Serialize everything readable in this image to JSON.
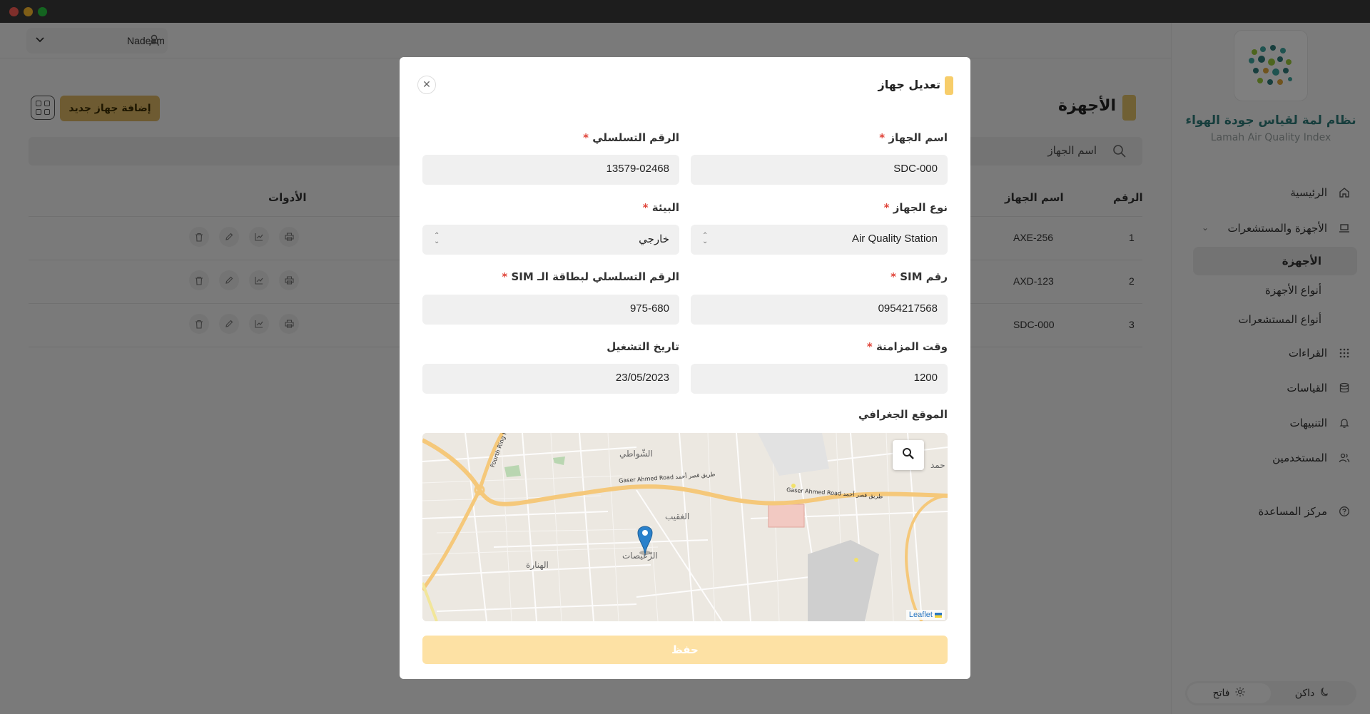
{
  "window": {
    "controls": [
      "close",
      "minimize",
      "maximize"
    ]
  },
  "sidebar": {
    "app_title": "نظام لمة لقياس جودة الهواء",
    "app_subtitle": "Lamah Air Quality Index",
    "items": [
      {
        "label": "الرئيسية",
        "icon": "home-icon"
      },
      {
        "label": "الأجهزة والمستشعرات",
        "icon": "laptop-icon"
      },
      {
        "label": "القراءات",
        "icon": "grid-dots-icon"
      },
      {
        "label": "القياسات",
        "icon": "database-icon"
      },
      {
        "label": "التنبيهات",
        "icon": "bell-icon"
      },
      {
        "label": "المستخدمين",
        "icon": "users-icon"
      },
      {
        "label": "مركز المساعدة",
        "icon": "help-icon"
      }
    ],
    "sub_items": [
      {
        "label": "الأجهزة",
        "active": true
      },
      {
        "label": "أنواع الأجهزة",
        "active": false
      },
      {
        "label": "أنواع المستشعرات",
        "active": false
      }
    ],
    "theme": {
      "dark_label": "داكن",
      "light_label": "فاتح",
      "selected": "light"
    }
  },
  "header": {
    "user_name": "Nadeem"
  },
  "main": {
    "title": "الأجهزة",
    "add_button": "إضافة جهاز جديد",
    "search_placeholder": "اسم الجهاز",
    "columns": {
      "number": "الرقم",
      "name": "اسم الجهاز",
      "tools": "الأدوات"
    },
    "rows": [
      {
        "number": "1",
        "name": "AXE-256"
      },
      {
        "number": "2",
        "name": "AXD-123"
      },
      {
        "number": "3",
        "name": "SDC-000"
      }
    ]
  },
  "modal": {
    "title": "تعديل جهاز",
    "fields": {
      "device_name": {
        "label": "اسم الجهاز",
        "value": "SDC-000"
      },
      "serial_number": {
        "label": "الرقم التسلسلي",
        "value": "13579-02468"
      },
      "device_type": {
        "label": "نوع الجهاز",
        "value": "Air Quality Station"
      },
      "environment": {
        "label": "البيئة",
        "value": "خارجي"
      },
      "sim_number": {
        "label": "رقم SIM",
        "value": "0954217568"
      },
      "sim_serial": {
        "label": "الرقم التسلسلي لبطاقة الـ SIM",
        "value": "975-680"
      },
      "sync_time": {
        "label": "وقت المزامنة",
        "value": "1200"
      },
      "start_date": {
        "label": "تاريخ التشغيل",
        "value": "23/05/2023"
      }
    },
    "location_label": "الموقع الجغرافي",
    "map": {
      "labels": {
        "shawahi": "الشّواطي",
        "ghuqaib": "الغقيب",
        "zuaisat": "الزّعيصات",
        "hunara": "الهنارة",
        "hamad": "حمد",
        "road1": "Gaser Ahmed Road طريق قصر أحمد",
        "road2": "Gaser Ahmed Road طريق قصر أحمد",
        "ring": "Fourth Ring R"
      },
      "attribution": "Leaflet"
    },
    "save_button": "حفظ"
  }
}
